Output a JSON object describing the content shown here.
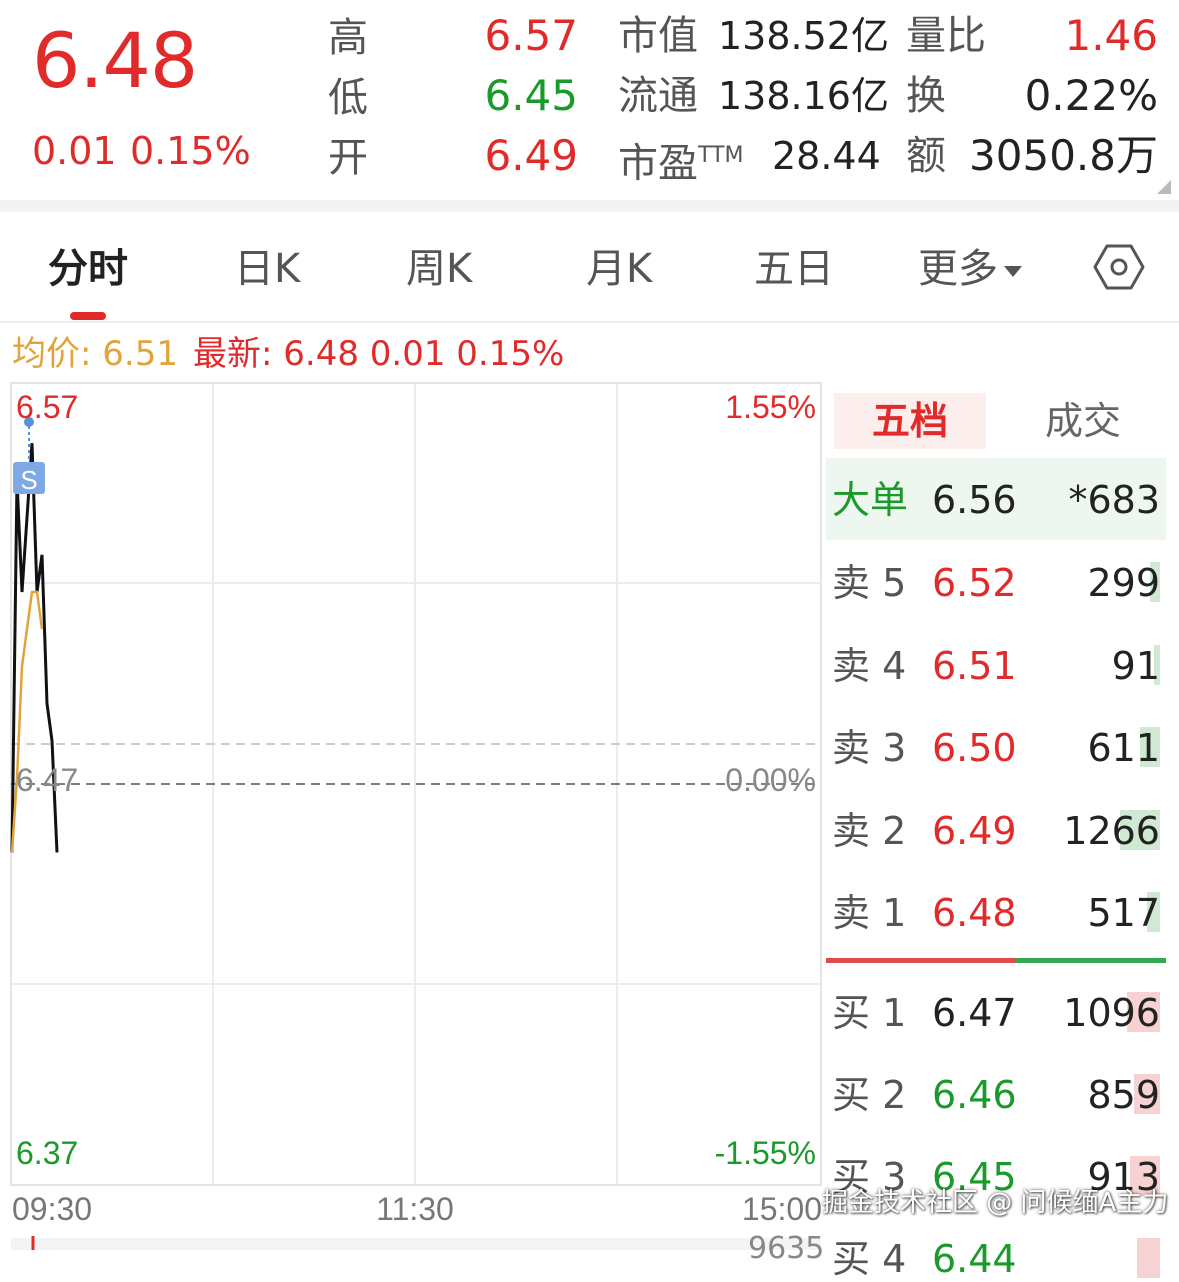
{
  "quote": {
    "price": "6.48",
    "change_abs": "0.01",
    "change_pct": "0.15%",
    "stats": [
      {
        "label": "高",
        "value": "6.57",
        "color": "#e12b2b"
      },
      {
        "label": "低",
        "value": "6.45",
        "color": "#1a9a2a"
      },
      {
        "label": "开",
        "value": "6.49",
        "color": "#e12b2b"
      }
    ],
    "market_cap": {
      "label": "市值",
      "value": "138.52亿"
    },
    "float_cap": {
      "label": "流通",
      "value": "138.16亿"
    },
    "pe": {
      "label": "市盈",
      "sup": "TTM",
      "value": "28.44"
    },
    "volume_ratio": {
      "label": "量比",
      "value": "1.46"
    },
    "turnover": {
      "label": "换",
      "value": "0.22%"
    },
    "amount": {
      "label": "额",
      "value": "3050.8万"
    }
  },
  "tabs": {
    "fenshi": "分时",
    "daily": "日K",
    "weekly": "周K",
    "monthly": "月K",
    "five_day": "五日",
    "more": "更多",
    "settings_icon": "hexagon-settings-icon"
  },
  "info": {
    "avg": "均价: 6.51",
    "latest": "最新: 6.48  0.01  0.15%"
  },
  "chart_data": {
    "type": "line",
    "title": "",
    "y_left_ticks": [
      "6.57",
      "6.47",
      "6.37"
    ],
    "y_right_ticks": [
      "1.55%",
      "0.00%",
      "-1.55%"
    ],
    "x_ticks": [
      "09:30",
      "11:30",
      "15:00"
    ],
    "ylim": [
      6.37,
      6.57
    ],
    "prev_close": 6.47,
    "marker": "S",
    "series": [
      {
        "values": [
          6.45,
          6.55,
          6.52,
          6.54,
          6.56,
          6.52,
          6.53,
          6.49,
          6.48,
          6.45
        ],
        "color": "#111111"
      },
      {
        "values": [
          6.45,
          6.47,
          6.5,
          6.51,
          6.52,
          6.52,
          6.51
        ],
        "color": "#e2a43a"
      }
    ],
    "colors": {
      "up": "#e12b2b",
      "down": "#1a9a2a",
      "neutral": "#888888"
    }
  },
  "orderbook": {
    "tab_active": "五档",
    "tab_other": "成交",
    "big_order": {
      "label": "大单",
      "price": "6.56",
      "volume": "*683"
    },
    "asks": [
      {
        "label": "卖 5",
        "price": "6.52",
        "volume": "299",
        "fill": 0.03
      },
      {
        "label": "卖 4",
        "price": "6.51",
        "volume": "91",
        "fill": 0.01
      },
      {
        "label": "卖 3",
        "price": "6.50",
        "volume": "611",
        "fill": 0.06
      },
      {
        "label": "卖 2",
        "price": "6.49",
        "volume": "1266",
        "fill": 0.12
      },
      {
        "label": "卖 1",
        "price": "6.48",
        "volume": "517",
        "fill": 0.04
      }
    ],
    "bids": [
      {
        "label": "买 1",
        "price": "6.47",
        "volume": "1096",
        "fill": 0.1
      },
      {
        "label": "买 2",
        "price": "6.46",
        "volume": "859",
        "fill": 0.08
      },
      {
        "label": "买 3",
        "price": "6.45",
        "volume": "913",
        "fill": 0.09
      },
      {
        "label": "买 4",
        "price": "6.44",
        "volume": "",
        "fill": 0.07
      }
    ],
    "partial_row_number": "9635",
    "ask_color": "#e12b2b",
    "bid_color": "#1a9a2a"
  },
  "watermark": "掘金技术社区 @ 问候缅A主力"
}
